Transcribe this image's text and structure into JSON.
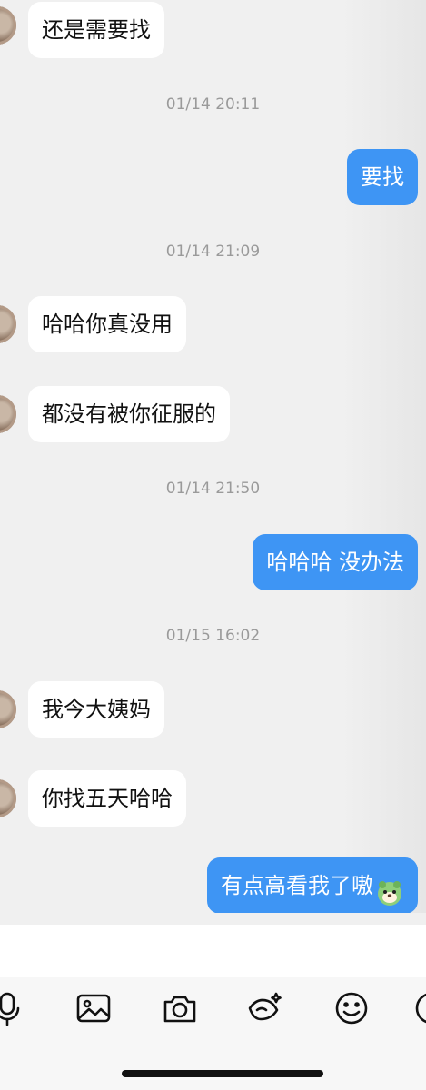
{
  "messages": [
    {
      "side": "left",
      "text": "还是需要找"
    },
    {
      "side": "time",
      "text": "01/14 20:11"
    },
    {
      "side": "right",
      "text": "要找"
    },
    {
      "side": "time",
      "text": "01/14 21:09"
    },
    {
      "side": "left",
      "text": "哈哈你真没用"
    },
    {
      "side": "left",
      "text": "都没有被你征服的"
    },
    {
      "side": "time",
      "text": "01/14 21:50"
    },
    {
      "side": "right",
      "text": "哈哈哈 没办法"
    },
    {
      "side": "time",
      "text": "01/15 16:02"
    },
    {
      "side": "left",
      "text": "我今大姨妈"
    },
    {
      "side": "left",
      "text": "你找五天哈哈"
    },
    {
      "side": "right",
      "text": "有点高看我了嗷",
      "sticker": "dog-sticker-icon"
    }
  ],
  "input": {
    "placeholder": ""
  },
  "toolbar": {
    "icons": [
      "microphone-icon",
      "image-icon",
      "camera-icon",
      "red-packet-icon",
      "emoji-icon",
      "more-icon"
    ]
  },
  "colors": {
    "bubble_right": "#3e95f4",
    "bubble_left": "#ffffff",
    "background": "#f0f0f0",
    "timestamp": "#9a9a9a"
  }
}
